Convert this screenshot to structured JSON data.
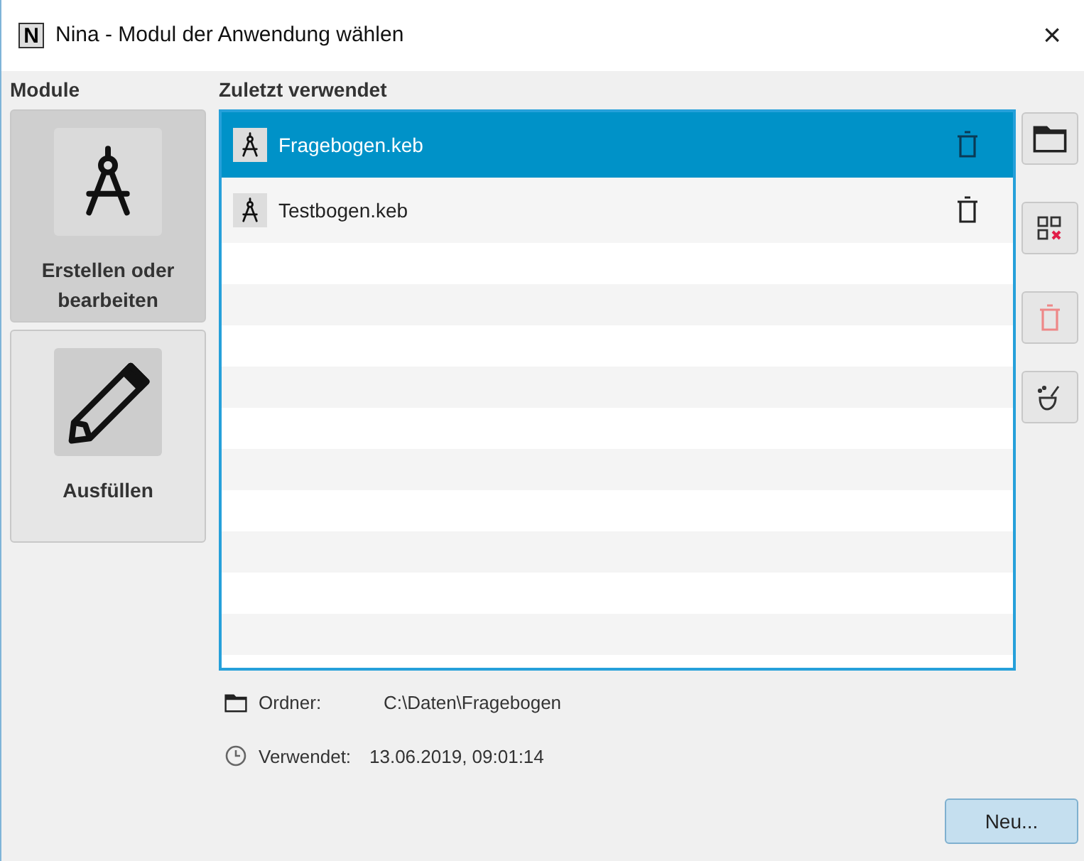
{
  "window": {
    "logo": "N",
    "title": "Nina - Modul der Anwendung wählen",
    "close": "×"
  },
  "modules": {
    "heading": "Module",
    "items": [
      {
        "kind": "compass",
        "label": "Erstellen oder bearbeiten",
        "selected": true
      },
      {
        "kind": "pencil",
        "label": "Ausfüllen",
        "selected": false
      }
    ]
  },
  "recent": {
    "heading": "Zuletzt verwendet",
    "items": [
      {
        "name": "Fragebogen.keb",
        "selected": true
      },
      {
        "name": "Testbogen.keb",
        "selected": false
      }
    ]
  },
  "side_buttons": [
    {
      "kind": "folder"
    },
    {
      "kind": "remove-missing"
    },
    {
      "kind": "delete"
    },
    {
      "kind": "clean"
    }
  ],
  "details": [
    {
      "kind": "folder",
      "label": "Ordner:",
      "value": "C:\\Daten\\Fragebogen"
    },
    {
      "kind": "clock",
      "label": "Verwendet:",
      "value": "13.06.2019, 09:01:14"
    }
  ],
  "new_button": "Neu..."
}
